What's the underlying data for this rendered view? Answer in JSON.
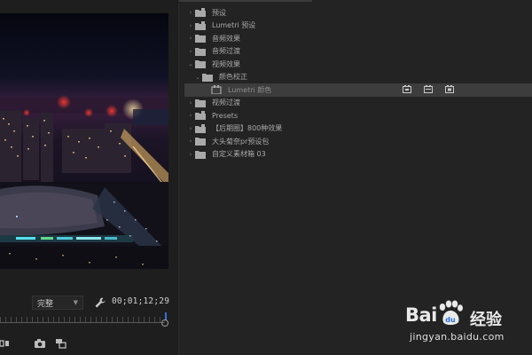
{
  "program_monitor": {
    "zoom_value": "完整",
    "timecode": "00;01;12;29",
    "icons": [
      "wrench-icon",
      "insert-icon",
      "camera-icon",
      "export-frame-icon"
    ]
  },
  "effects_panel": {
    "items": [
      {
        "label": "预设",
        "depth": 0,
        "twisty": "›",
        "icon": "preset-folder-icon"
      },
      {
        "label": "Lumetri 预设",
        "depth": 0,
        "twisty": "›",
        "icon": "preset-folder-icon"
      },
      {
        "label": "音频效果",
        "depth": 0,
        "twisty": "›",
        "icon": "folder-icon"
      },
      {
        "label": "音频过渡",
        "depth": 0,
        "twisty": "›",
        "icon": "folder-icon"
      },
      {
        "label": "视频效果",
        "depth": 0,
        "twisty": "⌄",
        "icon": "folder-icon"
      },
      {
        "label": "颜色校正",
        "depth": 1,
        "twisty": "⌄",
        "icon": "folder-icon"
      },
      {
        "label": "Lumetri 颜色",
        "depth": 2,
        "twisty": "",
        "icon": "effect-icon",
        "selected": true
      },
      {
        "label": "视频过渡",
        "depth": 0,
        "twisty": "›",
        "icon": "folder-icon"
      },
      {
        "label": "Presets",
        "depth": 0,
        "twisty": "›",
        "icon": "preset-folder-icon"
      },
      {
        "label": "【后期圈】800种效果",
        "depth": 0,
        "twisty": "›",
        "icon": "preset-folder-icon"
      },
      {
        "label": "大头菊奈pr预设包",
        "depth": 0,
        "twisty": "›",
        "icon": "folder-icon"
      },
      {
        "label": "自定义素材箱 03",
        "depth": 0,
        "twisty": "›",
        "icon": "folder-icon"
      }
    ],
    "badge_icons": [
      "accelerated-effect-icon",
      "32bit-color-icon",
      "yuv-effect-icon"
    ]
  },
  "watermark": {
    "brand": "Bai",
    "brand_cn": "经验",
    "url": "jingyan.baidu.com"
  },
  "colors": {
    "panel_bg": "#232323",
    "selected_row": "#3d3d3d",
    "playhead": "#3b6ed8"
  }
}
